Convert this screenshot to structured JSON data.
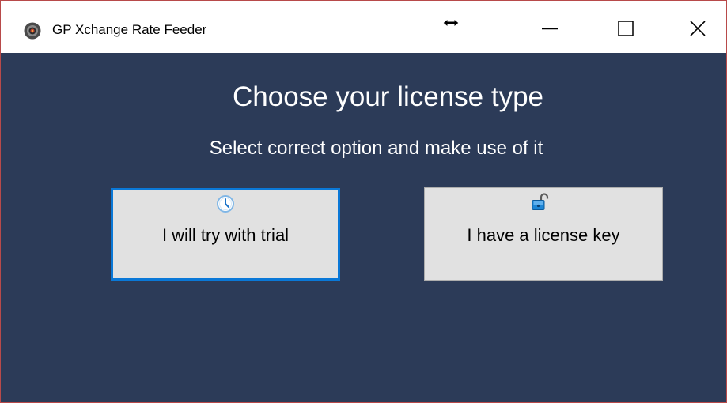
{
  "window": {
    "title": "GP Xchange Rate Feeder",
    "icon": "app-disc-icon",
    "controls": {
      "minimize_icon": "minimize-icon",
      "maximize_icon": "maximize-icon",
      "close_icon": "close-icon"
    },
    "cursor": "horizontal-resize-cursor"
  },
  "main": {
    "heading": "Choose your license type",
    "subheading": "Select correct option and make use of it",
    "buttons": [
      {
        "label": "I will try with trial",
        "icon": "clock-icon",
        "focused": true
      },
      {
        "label": "I have a license key",
        "icon": "unlocked-padlock-icon",
        "focused": false
      }
    ]
  },
  "colors": {
    "background": "#2c3b58",
    "accent": "#0a78d7",
    "button_face": "#e1e1e1",
    "text_light": "#ffffff"
  }
}
